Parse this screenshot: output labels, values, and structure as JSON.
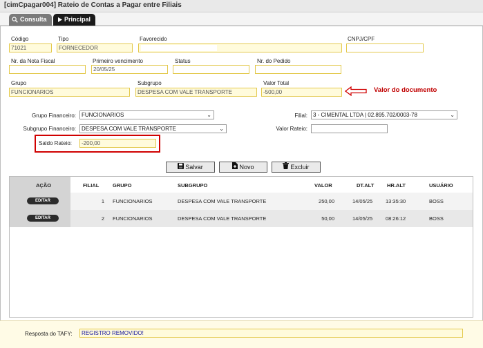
{
  "window": {
    "title": "[cimCpagar004] Rateio de Contas a Pagar entre Filiais"
  },
  "tabs": [
    {
      "label": "Consulta",
      "icon": "search-icon"
    },
    {
      "label": "Principal",
      "icon": "play-icon"
    }
  ],
  "form": {
    "codigo": {
      "label": "Código",
      "value": "71021"
    },
    "tipo": {
      "label": "Tipo",
      "value": "FORNECEDOR"
    },
    "favorecido": {
      "label": "Favorecido",
      "value": ""
    },
    "cnpj": {
      "label": "CNPJ/CPF",
      "value": ""
    },
    "nota_fiscal": {
      "label": "Nr. da Nota Fiscal",
      "value": ""
    },
    "primeiro_vencimento": {
      "label": "Primeiro vencimento",
      "value": "20/05/25"
    },
    "status": {
      "label": "Status",
      "value": ""
    },
    "pedido": {
      "label": "Nr. do Pedido",
      "value": ""
    },
    "grupo": {
      "label": "Grupo",
      "value": "FUNCIONARIOS"
    },
    "subgrupo": {
      "label": "Subgrupo",
      "value": "DESPESA COM VALE TRANSPORTE"
    },
    "valor_total": {
      "label": "Valor Total",
      "value": "-500,00"
    }
  },
  "annotation": {
    "text": "Valor do documento",
    "color": "#c00000"
  },
  "rateio": {
    "grupo_financeiro": {
      "label": "Grupo Financeiro:",
      "value": "FUNCIONARIOS"
    },
    "subgrupo_financeiro": {
      "label": "Subgrupo Financeiro:",
      "value": "DESPESA COM VALE TRANSPORTE"
    },
    "filial": {
      "label": "Filial:",
      "value": "3 - CIMENTAL LTDA | 02.895.702/0003-78"
    },
    "valor_rateio": {
      "label": "Valor Rateio:",
      "value": ""
    },
    "saldo_rateio": {
      "label": "Saldo Rateio:",
      "value": "-200,00"
    }
  },
  "toolbar": {
    "salvar": "Salvar",
    "novo": "Novo",
    "excluir": "Excluir"
  },
  "grid": {
    "headers": {
      "acao": "AÇÃO",
      "filial": "FILIAL",
      "grupo": "GRUPO",
      "subgrupo": "SUBGRUPO",
      "valor": "VALOR",
      "dt_alt": "DT.ALT",
      "hr_alt": "HR.ALT",
      "usuario": "USUÁRIO"
    },
    "rows": [
      {
        "action": "EDITAR",
        "filial": "1",
        "grupo": "FUNCIONARIOS",
        "subgrupo": "DESPESA COM VALE TRANSPORTE",
        "valor": "250,00",
        "dt_alt": "14/05/25",
        "hr_alt": "13:35:30",
        "usuario": "BOSS"
      },
      {
        "action": "EDITAR",
        "filial": "2",
        "grupo": "FUNCIONARIOS",
        "subgrupo": "DESPESA COM VALE TRANSPORTE",
        "valor": "50,00",
        "dt_alt": "14/05/25",
        "hr_alt": "08:26:12",
        "usuario": "BOSS"
      }
    ]
  },
  "footer": {
    "label": "Resposta do TAFY:",
    "value": "REGISTRO REMOVIDO!"
  }
}
